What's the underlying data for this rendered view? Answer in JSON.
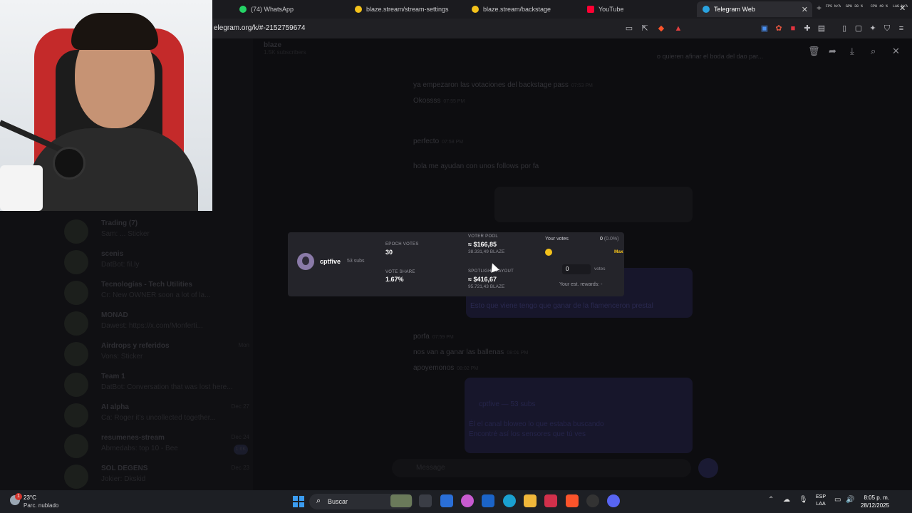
{
  "browser": {
    "tabs": [
      {
        "label": "(74) WhatsApp",
        "color": "#25d366",
        "active": false
      },
      {
        "label": "blaze.stream/stream-settings",
        "color": "#f4c21b",
        "active": false
      },
      {
        "label": "blaze.stream/backstage",
        "color": "#f4c21b",
        "active": false
      },
      {
        "label": "YouTube",
        "color": "#ff0033",
        "active": false
      },
      {
        "label": "Telegram Web",
        "color": "#2aa3e0",
        "active": true
      }
    ],
    "perf": {
      "fps": "FPS N/A",
      "gpu": "GPU 38 %",
      "cpu": "CPU 49 %",
      "lag": "LAG N/A"
    },
    "url": "elegram.org/k/#-2152759674"
  },
  "telegram": {
    "chat_title": "blaze",
    "chat_subtitle": "1.5K subscribers",
    "pinned": "o quieren afinar el boda del dao par...",
    "chats": [
      {
        "name": "Trading (7)",
        "preview": "Sam: ... Sticker",
        "date": "",
        "badge": ""
      },
      {
        "name": "scenis",
        "preview": "DatBot: fil.ly",
        "date": "",
        "badge": ""
      },
      {
        "name": "Tecnologías - Tech Utilities",
        "preview": "Cr: New OWNER soon a lot of la...",
        "date": "",
        "badge": ""
      },
      {
        "name": "MONAD",
        "preview": "Dawest: https://x.com/Monferti...",
        "date": "",
        "badge": ""
      },
      {
        "name": "Airdrops y referidos",
        "preview": "Vons: Sticker",
        "date": "Mon",
        "badge": ""
      },
      {
        "name": "Team 1",
        "preview": "DatBot: Conversation that was lost here...",
        "date": "",
        "badge": ""
      },
      {
        "name": "AI alpha",
        "preview": "Ca: Roger it's uncollected together...",
        "date": "Dec 27",
        "badge": ""
      },
      {
        "name": "resumenes-stream",
        "preview": "Abmedabs: top 10 - Bee",
        "date": "Dec 24",
        "badge": "1.6K"
      },
      {
        "name": "SOL DEGENS",
        "preview": "Jokier: Dkskid",
        "date": "Dec 23",
        "badge": ""
      }
    ],
    "messages": [
      {
        "text": "ya empezaron las votaciones del backstage pass",
        "time": "07:53 PM"
      },
      {
        "text": "Okossss",
        "time": "07:55 PM"
      },
      {
        "text": "perfecto",
        "time": "07:58 PM"
      },
      {
        "text": "hola me ayudan con unos follows por fa",
        "time": ""
      },
      {
        "text": "Esto que viene tengo que ganar de la flamenceron prestal",
        "time": ""
      },
      {
        "text": "porfa",
        "time": "07:59 PM"
      },
      {
        "text": "nos van a ganar las ballenas",
        "time": "08:01 PM"
      },
      {
        "text": "apoyemonos",
        "time": "08:02 PM"
      }
    ],
    "forward_preview": {
      "line1": "cptfive — 53 subs",
      "line2": "Él el canal bloweo lo que estaba buscando",
      "line3": "Encontré así los sensores que tú ves"
    },
    "compose_placeholder": "Message"
  },
  "vote_card": {
    "channel_name": "cptfive",
    "subs": "53 subs",
    "epoch_votes_label": "EPOCH VOTES",
    "epoch_votes": "30",
    "voter_pool_label": "VOTER POOL",
    "voter_pool_usd": "≈ $166,85",
    "voter_pool_blaze": "38.331,49 BLAZE",
    "vote_share_label": "VOTE SHARE",
    "vote_share": "1.67%",
    "spotlight_label": "SPOTLIGHT PAYOUT",
    "spotlight_usd": "≈ $416,67",
    "spotlight_blaze": "95.721,43 BLAZE",
    "your_votes_label": "Your votes",
    "your_votes_value": "0",
    "your_votes_pct": "(0.0%)",
    "max_label": "Max",
    "input_value": "0",
    "votes_unit": "votes",
    "est_rewards": "Your est. rewards: -",
    "slider_level": 0,
    "accent": "#f4c21b"
  },
  "taskbar": {
    "temp": "23°C",
    "condition": "Parc. nublado",
    "notif": "1",
    "search_placeholder": "Buscar",
    "lang_top": "ESP",
    "lang_bottom": "LAA",
    "time": "8:05 p. m.",
    "date": "28/12/2025"
  }
}
